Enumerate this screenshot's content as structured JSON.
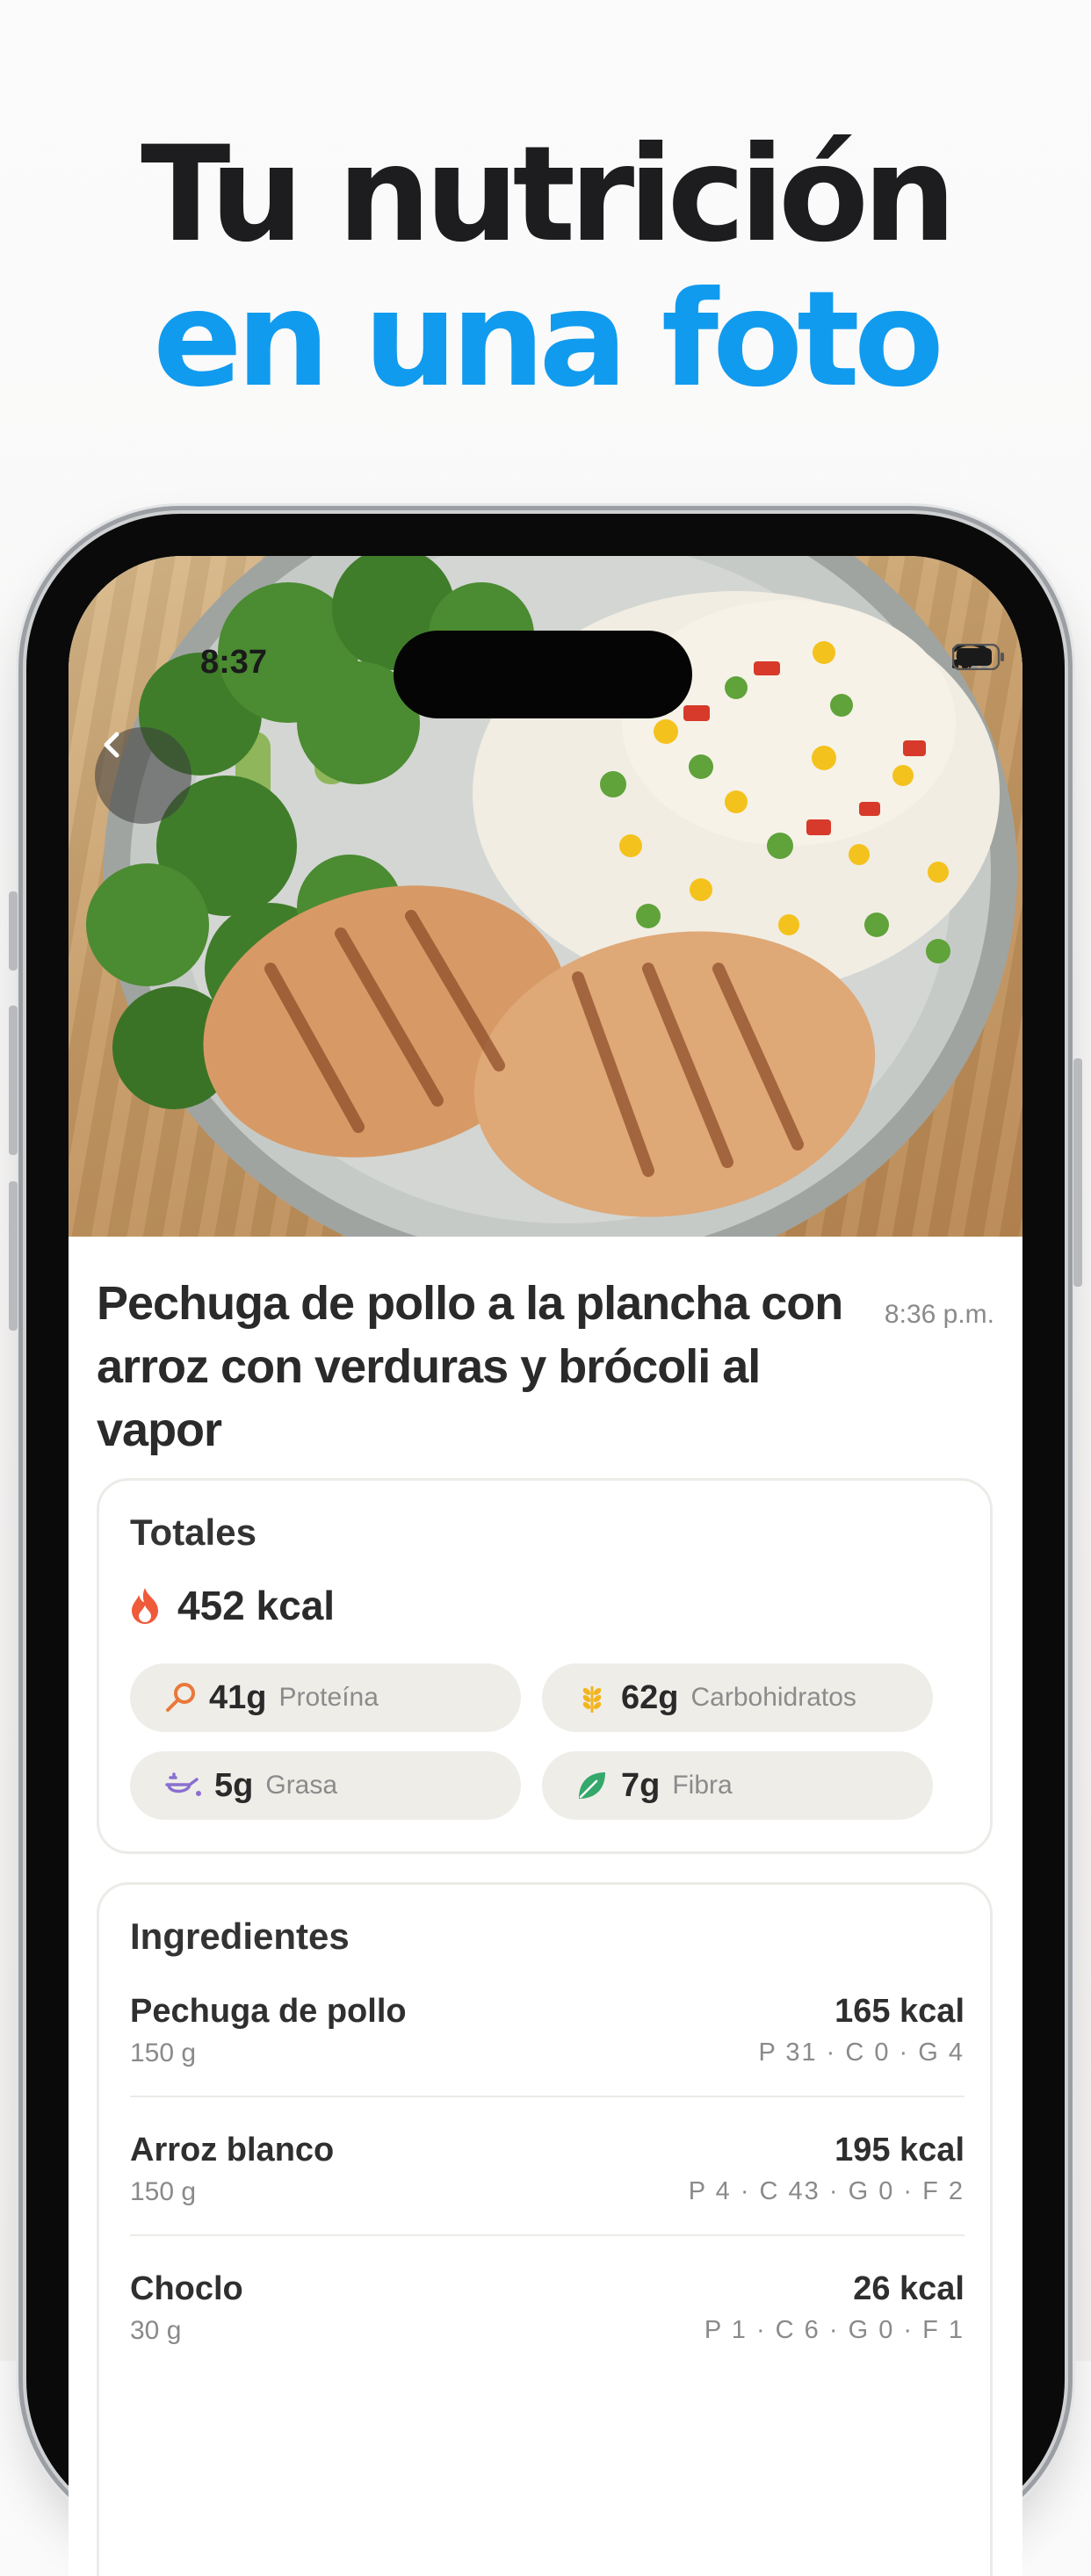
{
  "headline": {
    "line1": "Tu nutrición",
    "line2": "en una foto"
  },
  "status_bar": {
    "time": "8:37"
  },
  "meal": {
    "title": "Pechuga de pollo a la plancha con arroz con verduras y brócoli al vapor",
    "time": "8:36 p.m."
  },
  "totals": {
    "title": "Totales",
    "kcal": "452 kcal",
    "macros": [
      {
        "value": "41g",
        "label": "Proteína",
        "icon": "drumstick-icon",
        "color": "#e8793a"
      },
      {
        "value": "62g",
        "label": "Carbohidratos",
        "icon": "wheat-icon",
        "color": "#f2b51f"
      },
      {
        "value": "5g",
        "label": "Grasa",
        "icon": "oil-drop-icon",
        "color": "#8a6fd1"
      },
      {
        "value": "7g",
        "label": "Fibra",
        "icon": "leaf-icon",
        "color": "#35a86c"
      }
    ]
  },
  "ingredients": {
    "title": "Ingredientes",
    "items": [
      {
        "name": "Pechuga de pollo",
        "qty": "150 g",
        "kcal": "165 kcal",
        "macros": "P 31 · C 0 · G 4"
      },
      {
        "name": "Arroz blanco",
        "qty": "150 g",
        "kcal": "195 kcal",
        "macros": "P 4 · C 43 · G 0 · F 2"
      },
      {
        "name": "Choclo",
        "qty": "30 g",
        "kcal": "26 kcal",
        "macros": "P 1 · C 6 · G 0 · F 1"
      }
    ]
  },
  "colors": {
    "accent": "#119bef",
    "flame": "#ef5a3a"
  }
}
